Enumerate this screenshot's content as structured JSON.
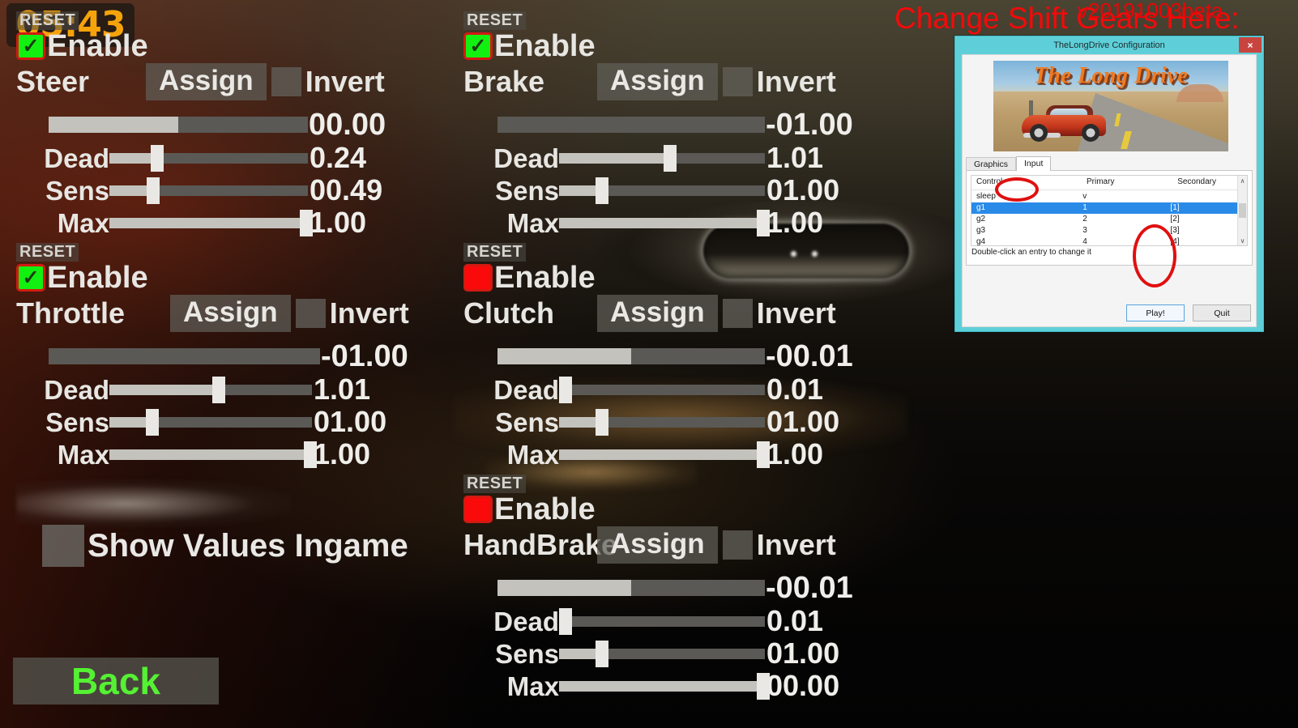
{
  "overlay": {
    "timer": "05:43",
    "annotation_change": "Change Shift Gears Here:",
    "annotation_version": "v20191003beta"
  },
  "labels": {
    "reset": "RESET",
    "enable": "Enable",
    "assign": "Assign",
    "invert": "Invert",
    "dead": "Dead",
    "sens": "Sens",
    "max": "Max"
  },
  "controls": [
    {
      "name": "Steer",
      "enabled": true,
      "value": "00.00",
      "value_fill_pct": 50,
      "dead": "0.24",
      "dead_pct": 24,
      "sens": "00.49",
      "sens_pct": 22,
      "max": "1.00",
      "max_pct": 100
    },
    {
      "name": "Brake",
      "enabled": true,
      "value": "-01.00",
      "value_fill_pct": 0,
      "dead": "1.01",
      "dead_pct": 54,
      "sens": "01.00",
      "sens_pct": 21,
      "max": "1.00",
      "max_pct": 100
    },
    {
      "name": "Throttle",
      "enabled": true,
      "value": "-01.00",
      "value_fill_pct": 0,
      "dead": "1.01",
      "dead_pct": 54,
      "sens": "01.00",
      "sens_pct": 21,
      "max": "1.00",
      "max_pct": 100
    },
    {
      "name": "Clutch",
      "enabled": false,
      "value": "-00.01",
      "value_fill_pct": 50,
      "dead": "0.01",
      "dead_pct": 2,
      "sens": "01.00",
      "sens_pct": 21,
      "max": "1.00",
      "max_pct": 100
    },
    {
      "name": "HandBrake",
      "enabled": false,
      "value": "-00.01",
      "value_fill_pct": 50,
      "dead": "0.01",
      "dead_pct": 2,
      "sens": "01.00",
      "sens_pct": 21,
      "max": "00.00",
      "max_pct": 100
    }
  ],
  "show_values_ingame": {
    "label": "Show Values Ingame",
    "checked": false
  },
  "back_button": "Back",
  "dialog": {
    "title": "TheLongDrive Configuration",
    "close_icon": "×",
    "banner_title": "The Long Drive",
    "tabs": [
      {
        "label": "Graphics",
        "active": false
      },
      {
        "label": "Input",
        "active": true
      }
    ],
    "table": {
      "columns": [
        "Control",
        "Primary",
        "Secondary"
      ],
      "rows": [
        {
          "control": "sleep",
          "primary": "v",
          "secondary": "",
          "selected": false
        },
        {
          "control": "g1",
          "primary": "1",
          "secondary": "[1]",
          "selected": true
        },
        {
          "control": "g2",
          "primary": "2",
          "secondary": "[2]",
          "selected": false
        },
        {
          "control": "g3",
          "primary": "3",
          "secondary": "[3]",
          "selected": false
        },
        {
          "control": "g4",
          "primary": "4",
          "secondary": "[4]",
          "selected": false
        }
      ]
    },
    "hint": "Double-click an entry to change it",
    "scroll_up_icon": "∧",
    "scroll_down_icon": "∨",
    "buttons": {
      "play": "Play!",
      "quit": "Quit"
    }
  },
  "colors": {
    "enabled_green": "#12F012",
    "disabled_red": "#FA0A0A",
    "annotation_red": "#E01010",
    "timer_orange": "#F5A30B",
    "back_green": "#55F133",
    "dialog_frame": "#5ecfd8",
    "row_select_blue": "#2a8ae8"
  }
}
